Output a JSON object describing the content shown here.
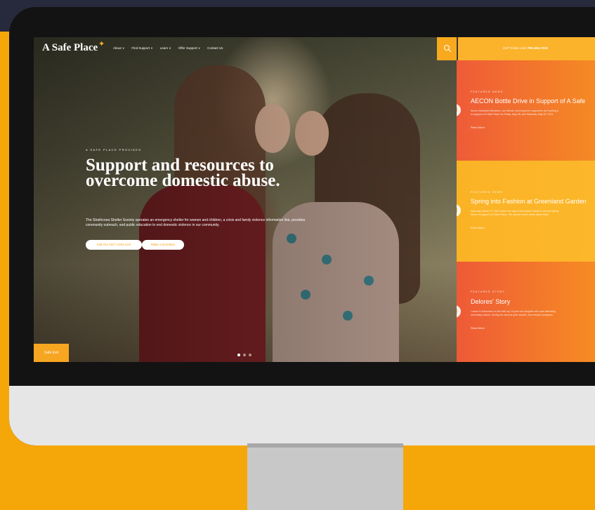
{
  "site": {
    "logo_text": "A Safe Place",
    "nav": [
      "About ∨",
      "Find Support ∨",
      "Learn ∨",
      "Offer Support ∨",
      "Contact Us"
    ],
    "crisis_line_label": "24/7 Crisis Line",
    "crisis_line_number": "780.464.7233"
  },
  "hero": {
    "eyebrow": "A SAFE PLACE PROVIDES",
    "headline": "Support and resources to overcome domestic abuse.",
    "description": "The Strathcona Shelter Society operates an emergency shelter for women and children, a crisis and family violence information line, provides community outreach, and public education to end domestic violence in our community.",
    "button_primary": "Call Our 24/7 Crisis Line",
    "button_secondary": "Make a Donation",
    "safe_exit": "Safe Exit"
  },
  "featured": [
    {
      "label": "FEATURED NEWS",
      "title": "AECON Bottle Drive in Support of A Safe",
      "excerpt": "Aecon Industrial (Western), our friends, and long-time supporters are hosting a\nin support of A Safe Place on Friday, May 28, and Saturday, May 29, 2021.",
      "read_more": "Read More"
    },
    {
      "label": "FEATURED NEWS",
      "title": "Spring into Fashion at Greenland Garden",
      "excerpt": "Saturday, March 27, 2021 marks the day of Greenland Garden's annual Spring\nShow in support of A Safe Place. The annual event, which dates back,",
      "read_more": "Read More"
    },
    {
      "label": "FEATURED STORY",
      "title": "Delores' Story",
      "excerpt": "I came to Edmonton to live with my 19-year old daughter who was attending\nsecondary school. During her second year studies, she became pregnant.",
      "read_more": "Read More"
    }
  ],
  "colors": {
    "brand_orange": "#f5a70a",
    "accent_gold": "#fbb32b",
    "panel_red_orange": "#ef5b38",
    "background_dark": "#272a3c"
  }
}
